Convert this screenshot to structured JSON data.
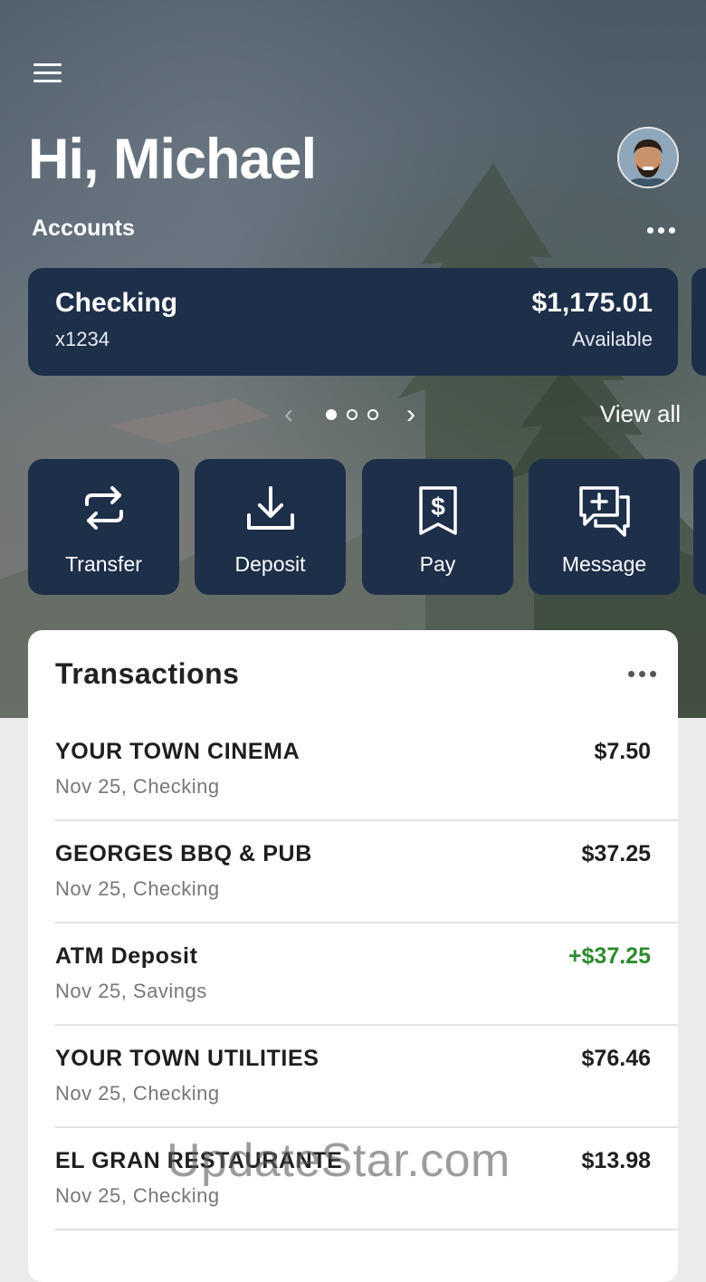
{
  "header": {
    "greeting": "Hi, Michael",
    "accounts_label": "Accounts"
  },
  "account": {
    "name": "Checking",
    "number": "x1234",
    "balance": "$1,175.01",
    "balance_label": "Available",
    "card_color": "#1d2f49"
  },
  "carousel": {
    "page_count": 3,
    "active_page": 1,
    "view_all_label": "View all"
  },
  "actions": [
    {
      "label": "Transfer",
      "icon": "transfer-arrows-icon"
    },
    {
      "label": "Deposit",
      "icon": "download-tray-icon"
    },
    {
      "label": "Pay",
      "icon": "dollar-receipt-icon"
    },
    {
      "label": "Message",
      "icon": "message-plus-icon"
    }
  ],
  "transactions": {
    "title": "Transactions",
    "items": [
      {
        "merchant": "YOUR TOWN CINEMA",
        "meta": "Nov 25, Checking",
        "amount": "$7.50",
        "credit": false
      },
      {
        "merchant": "GEORGES BBQ & PUB",
        "meta": "Nov 25, Checking",
        "amount": "$37.25",
        "credit": false
      },
      {
        "merchant": "ATM Deposit",
        "meta": "Nov 25, Savings",
        "amount": "+$37.25",
        "credit": true
      },
      {
        "merchant": "YOUR TOWN UTILITIES",
        "meta": "Nov 25, Checking",
        "amount": "$76.46",
        "credit": false
      },
      {
        "merchant": "EL GRAN RESTAURANTE",
        "meta": "Nov 25, Checking",
        "amount": "$13.98",
        "credit": false
      }
    ]
  },
  "colors": {
    "card": "#1d2f49",
    "credit_amount": "#2e8a2e"
  },
  "watermark": "UpdateStar.com"
}
